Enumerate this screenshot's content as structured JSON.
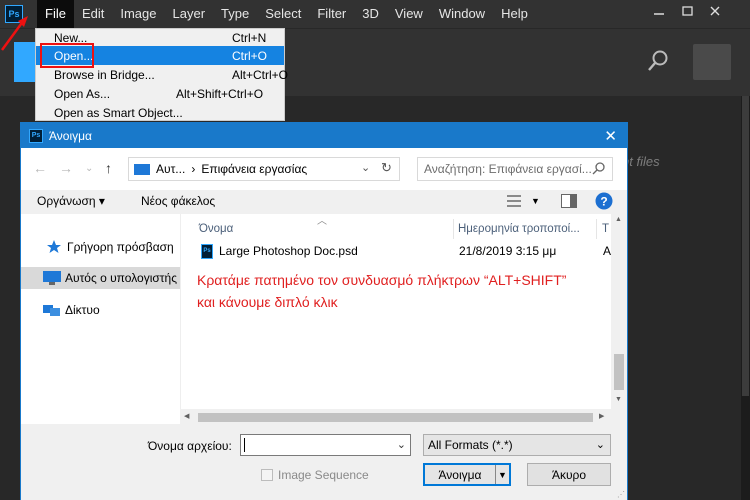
{
  "menubar": {
    "logo_text": "Ps",
    "items": [
      "File",
      "Edit",
      "Image",
      "Layer",
      "Type",
      "Select",
      "Filter",
      "3D",
      "View",
      "Window",
      "Help"
    ]
  },
  "file_menu": {
    "items": [
      {
        "label": "New...",
        "shortcut": "Ctrl+N"
      },
      {
        "label": "Open...",
        "shortcut": "Ctrl+O"
      },
      {
        "label": "Browse in Bridge...",
        "shortcut": "Alt+Ctrl+O"
      },
      {
        "label": "Open As...",
        "shortcut": "Alt+Shift+Ctrl+O"
      },
      {
        "label": "Open as Smart Object...",
        "shortcut": ""
      }
    ]
  },
  "background": {
    "recent_text": "nt files"
  },
  "dialog": {
    "icon_text": "Ps",
    "title": "Άνοιγμα",
    "address": {
      "part1": "Αυτ...",
      "sep": "›",
      "part2": "Επιφάνεια εργασίας"
    },
    "search_placeholder": "Αναζήτηση: Επιφάνεια εργασί...",
    "toolbar": {
      "organize": "Οργάνωση",
      "new_folder": "Νέος φάκελος"
    },
    "nav_items": [
      {
        "label": "Γρήγορη πρόσβαση"
      },
      {
        "label": "Αυτός ο υπολογιστής"
      },
      {
        "label": "Δίκτυο"
      }
    ],
    "columns": {
      "name": "Όνομα",
      "date": "Ημερομηνία τροποποί...",
      "type": "Τ"
    },
    "files": [
      {
        "icon": "Ps",
        "name": "Large Photoshop Doc.psd",
        "date": "21/8/2019 3:15 μμ",
        "type": "A"
      }
    ],
    "annotation": {
      "line1": "Κρατάμε πατημένο τον συνδυασμό πλήκτρων “ALT+SHIFT”",
      "line2": "και κάνουμε διπλό κλικ"
    },
    "filename_label": "Όνομα αρχείου:",
    "filename_value": "",
    "format": "All Formats (*.*)",
    "image_sequence": "Image Sequence",
    "open_button": "Άνοιγμα",
    "cancel_button": "Άκυρο"
  },
  "colors": {
    "ps_dark": "#323232",
    "ps_accent": "#31a8ff",
    "dialog_title": "#1979ca",
    "highlight": "#1583e1",
    "annotation": "#e02020"
  }
}
